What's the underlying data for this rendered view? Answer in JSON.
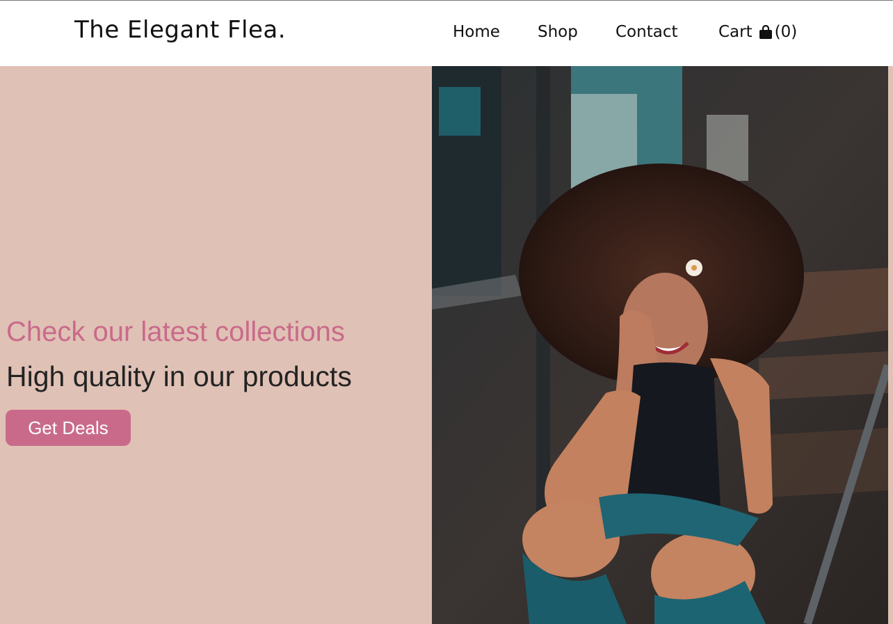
{
  "header": {
    "brand": "The Elegant Flea.",
    "nav": {
      "home": "Home",
      "shop": "Shop",
      "contact": "Contact",
      "cart_label": "Cart",
      "cart_count": "(0)"
    }
  },
  "hero": {
    "subtitle": "Check our latest collections",
    "headline": "High quality in our products",
    "cta_label": "Get Deals",
    "image_icon": "photo-woman-laughing-on-stairs"
  },
  "colors": {
    "accent": "#c96a8b",
    "hero_background": "#e0c1b5",
    "text_dark": "#232323"
  }
}
